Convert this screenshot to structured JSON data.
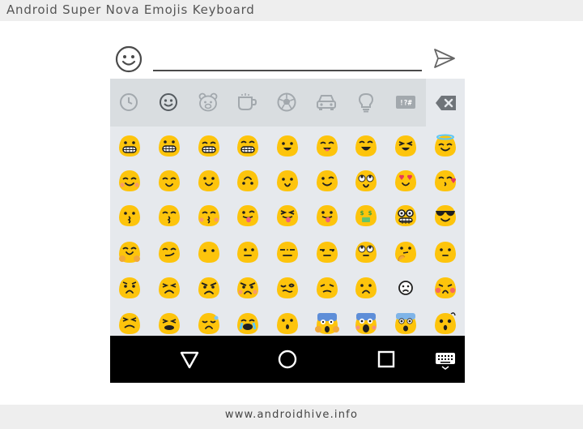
{
  "header": {
    "title": "Android Super Nova Emojis Keyboard"
  },
  "footer": {
    "url": "www.androidhive.info"
  },
  "input": {
    "value": ""
  },
  "categories": [
    {
      "name": "recent",
      "icon": "clock-icon",
      "selected": false
    },
    {
      "name": "people",
      "icon": "smiley-icon",
      "selected": true
    },
    {
      "name": "nature",
      "icon": "bear-icon",
      "selected": false
    },
    {
      "name": "food",
      "icon": "cup-icon",
      "selected": false
    },
    {
      "name": "activity",
      "icon": "soccer-ball-icon",
      "selected": false
    },
    {
      "name": "travel",
      "icon": "car-icon",
      "selected": false
    },
    {
      "name": "objects",
      "icon": "lightbulb-icon",
      "selected": false
    },
    {
      "name": "symbols",
      "icon": "symbols-icon",
      "label": "!?#",
      "selected": false
    }
  ],
  "emoji_rows": [
    [
      "grinning-teeth",
      "grimacing",
      "grinning-squint",
      "beaming-grin",
      "smiling-open",
      "smiling-open-eyes",
      "laughing-closed",
      "squinting-tongue-wink",
      "halo-smile"
    ],
    [
      "blush-smile",
      "relieved",
      "slight-smile",
      "upside-down",
      "smile-plain",
      "winking",
      "rolling-eyes",
      "heart-eyes",
      "kissing-heart"
    ],
    [
      "kissing",
      "kissing-smiling-eyes",
      "kissing-closed-eyes",
      "winking-tongue",
      "squinting-tongue",
      "tongue-out",
      "money-mouth",
      "nerd-glasses",
      "cool-sunglasses"
    ],
    [
      "hugging",
      "smirk",
      "no-mouth",
      "neutral-side",
      "expressionless",
      "unamused",
      "eye-roll-up",
      "thinking",
      "flat-smile"
    ],
    [
      "worried",
      "persevering",
      "angry",
      "pouting",
      "confounded",
      "tired",
      "frowning",
      "frowning-outline",
      "flushed-red"
    ],
    [
      "weary",
      "triumph",
      "disappointed-relieved",
      "crying-loud",
      "hushed",
      "fearful-hands",
      "screaming",
      "anxious-sweat",
      "astonished"
    ]
  ],
  "nav": {
    "buttons": [
      "back",
      "home",
      "recents",
      "keyboard"
    ]
  },
  "colors": {
    "emoji_yellow": "#fdc40c",
    "emoji_feature": "#1f1f1f",
    "cat_icon": "#a2a8ad",
    "cat_icon_selected": "#555b60",
    "banner_bg": "#eeeeee",
    "keyboard_bg": "#e6e9ed",
    "category_bg": "#d9dde0"
  }
}
